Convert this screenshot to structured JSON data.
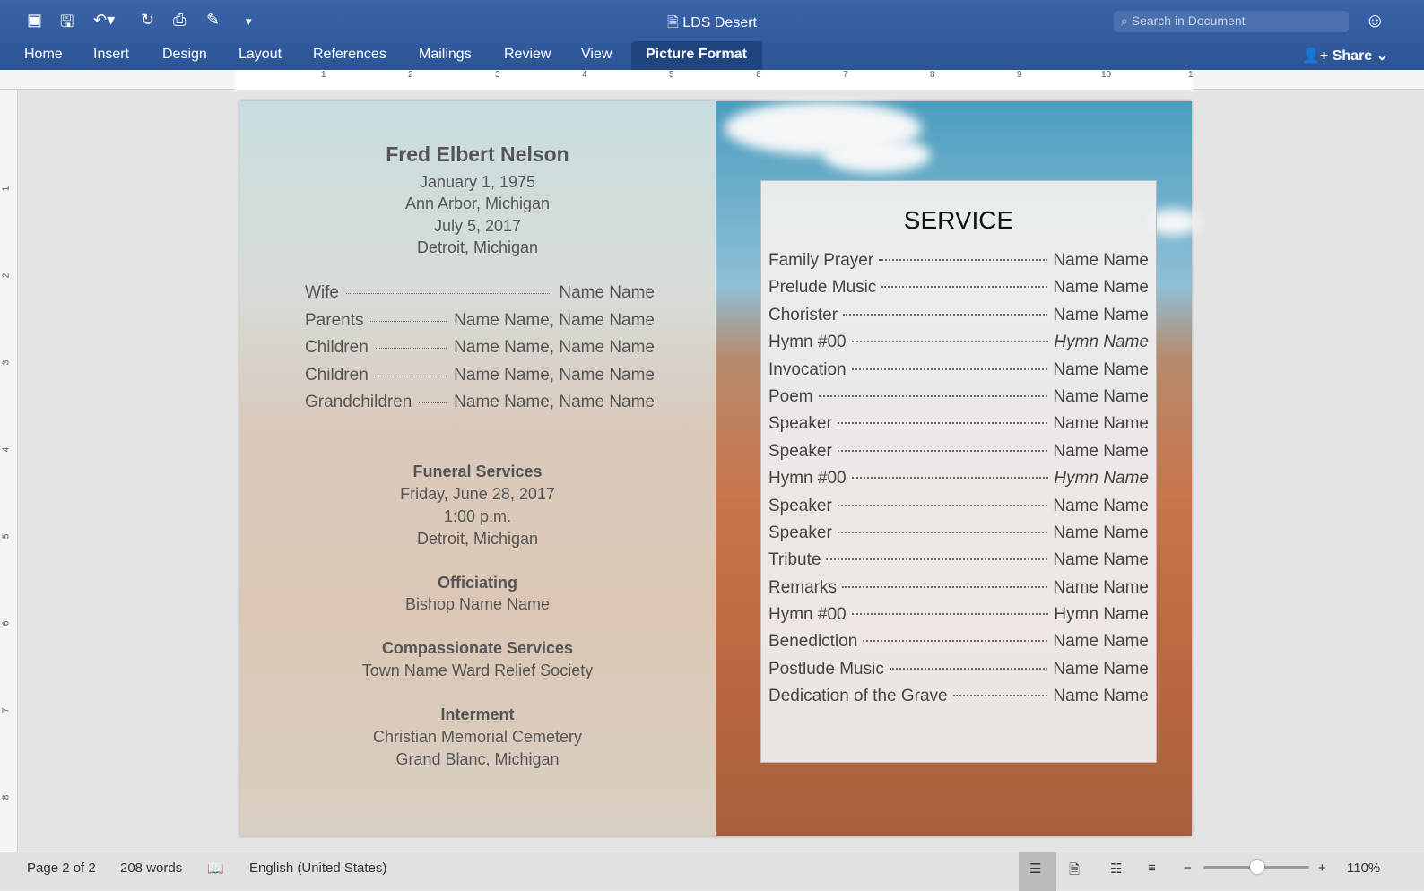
{
  "window": {
    "title": "LDS Desert",
    "search_placeholder": "Search in Document",
    "share": "Share"
  },
  "tabs": [
    "Home",
    "Insert",
    "Design",
    "Layout",
    "References",
    "Mailings",
    "Review",
    "View",
    "Picture Format"
  ],
  "ruler": [
    "1",
    "2",
    "3",
    "4",
    "5",
    "6",
    "7",
    "8",
    "9",
    "10",
    "1"
  ],
  "vruler": [
    "1",
    "2",
    "3",
    "4",
    "5",
    "6",
    "7",
    "8"
  ],
  "left": {
    "name": "Fred Elbert Nelson",
    "birth_date": "January 1, 1975",
    "birth_place": "Ann Arbor, Michigan",
    "death_date": "July 5, 2017",
    "death_place": "Detroit, Michigan",
    "family": [
      {
        "label": "Wife",
        "value": "Name Name"
      },
      {
        "label": "Parents",
        "value": "Name Name, Name Name"
      },
      {
        "label": "Children",
        "value": "Name Name, Name Name"
      },
      {
        "label": "Children",
        "value": "Name Name, Name Name"
      },
      {
        "label": "Grandchildren",
        "value": "Name Name, Name Name"
      }
    ],
    "funeral_heading": "Funeral Services",
    "funeral_date": "Friday, June 28, 2017",
    "funeral_time": "1:00 p.m.",
    "funeral_place": "Detroit, Michigan",
    "officiating_heading": "Officiating",
    "officiating": "Bishop Name Name",
    "compassionate_heading": "Compassionate Services",
    "compassionate": "Town Name Ward Relief Society",
    "interment_heading": "Interment",
    "interment_place": "Christian Memorial Cemetery",
    "interment_city": "Grand Blanc, Michigan"
  },
  "service": {
    "title": "SERVICE",
    "items": [
      {
        "label": "Family Prayer",
        "value": "Name Name"
      },
      {
        "label": "Prelude Music",
        "value": "Name Name"
      },
      {
        "label": "Chorister",
        "value": "Name Name"
      },
      {
        "label": "Hymn #00",
        "value": "Hymn Name",
        "italic": true
      },
      {
        "label": "Invocation",
        "value": "Name Name"
      },
      {
        "label": "Poem",
        "value": "Name Name"
      },
      {
        "label": "Speaker",
        "value": "Name Name"
      },
      {
        "label": "Speaker",
        "value": "Name Name"
      },
      {
        "label": "Hymn #00",
        "value": "Hymn Name",
        "italic": true
      },
      {
        "label": "Speaker",
        "value": "Name Name"
      },
      {
        "label": "Speaker",
        "value": "Name Name"
      },
      {
        "label": "Tribute",
        "value": "Name Name"
      },
      {
        "label": "Remarks",
        "value": "Name Name"
      },
      {
        "label": "Hymn #00",
        "value": "Hymn Name"
      },
      {
        "label": "Benediction",
        "value": "Name Name"
      },
      {
        "label": "Postlude Music",
        "value": "Name Name"
      },
      {
        "label": "Dedication of the Grave",
        "value": "Name Name"
      }
    ]
  },
  "status": {
    "page": "Page 2 of 2",
    "words": "208 words",
    "language": "English (United States)",
    "zoom": "110%"
  }
}
